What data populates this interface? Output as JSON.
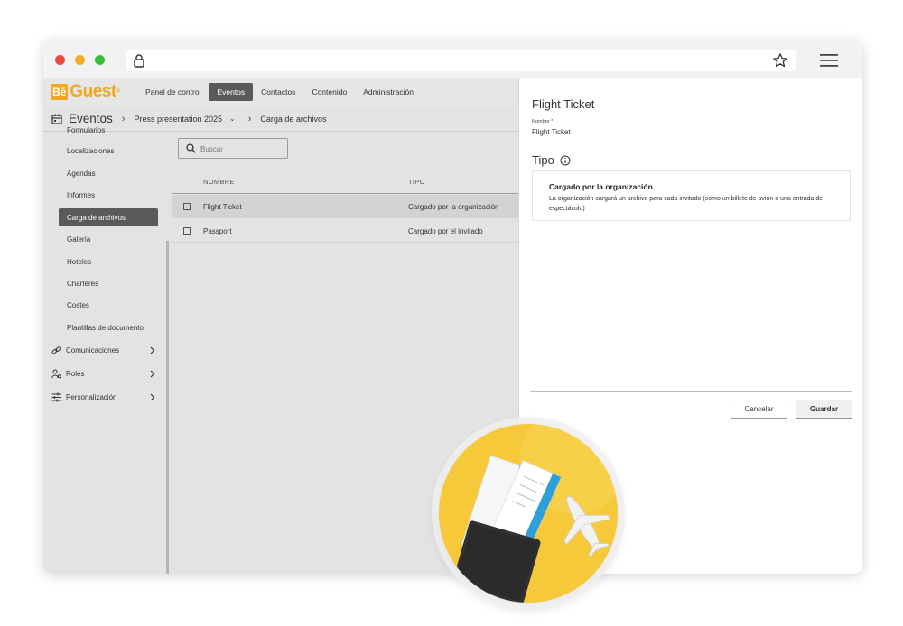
{
  "browser": {
    "icons": [
      "lock-icon",
      "star-icon",
      "hamburger-menu-icon"
    ]
  },
  "logo": {
    "be": "Bē",
    "guest": "Guest",
    "reg": "®"
  },
  "topnav": {
    "items": [
      {
        "label": "Panel de control",
        "active": false
      },
      {
        "label": "Eventos",
        "active": true
      },
      {
        "label": "Contactos",
        "active": false
      },
      {
        "label": "Contenido",
        "active": false
      },
      {
        "label": "Administración",
        "active": false
      }
    ]
  },
  "breadcrumb": {
    "title": "Eventos",
    "event": "Press presentation 2025",
    "current": "Carga de archivos"
  },
  "sidebar": {
    "items": [
      {
        "label": "Formularios",
        "active": false
      },
      {
        "label": "Localizaciones",
        "active": false
      },
      {
        "label": "Agendas",
        "active": false
      },
      {
        "label": "Informes",
        "active": false
      },
      {
        "label": "Carga de archivos",
        "active": true
      },
      {
        "label": "Galería",
        "active": false
      },
      {
        "label": "Hoteles",
        "active": false
      },
      {
        "label": "Chárteres",
        "active": false
      },
      {
        "label": "Costes",
        "active": false
      },
      {
        "label": "Plantillas de documento",
        "active": false
      }
    ],
    "groups": [
      {
        "label": "Comunicaciones",
        "icon": "link-icon"
      },
      {
        "label": "Roles",
        "icon": "roles-icon"
      },
      {
        "label": "Personalización",
        "icon": "sliders-icon"
      }
    ]
  },
  "search": {
    "placeholder": "Buscar"
  },
  "table": {
    "headers": {
      "name": "NOMBRE",
      "type": "TIPO"
    },
    "rows": [
      {
        "name": "Flight Ticket",
        "type": "Cargado por la organización",
        "selected": true
      },
      {
        "name": "Passport",
        "type": "Cargado por el invitado",
        "selected": false
      }
    ]
  },
  "panel": {
    "title": "Flight Ticket",
    "name_label": "Nombre *",
    "name_value": "Flight Ticket",
    "tipo_label": "Tipo",
    "card": {
      "title": "Cargado por la organización",
      "description": "La organización cargará un archivo para cada invitado (como un billete de avión o una entrada de espectáculo)"
    },
    "cancel_label": "Cancelar",
    "save_label": "Guardar"
  },
  "colors": {
    "brand": "#f0a81c",
    "active_nav": "#5a5a5a",
    "photo_bg": "#f5c93a"
  }
}
